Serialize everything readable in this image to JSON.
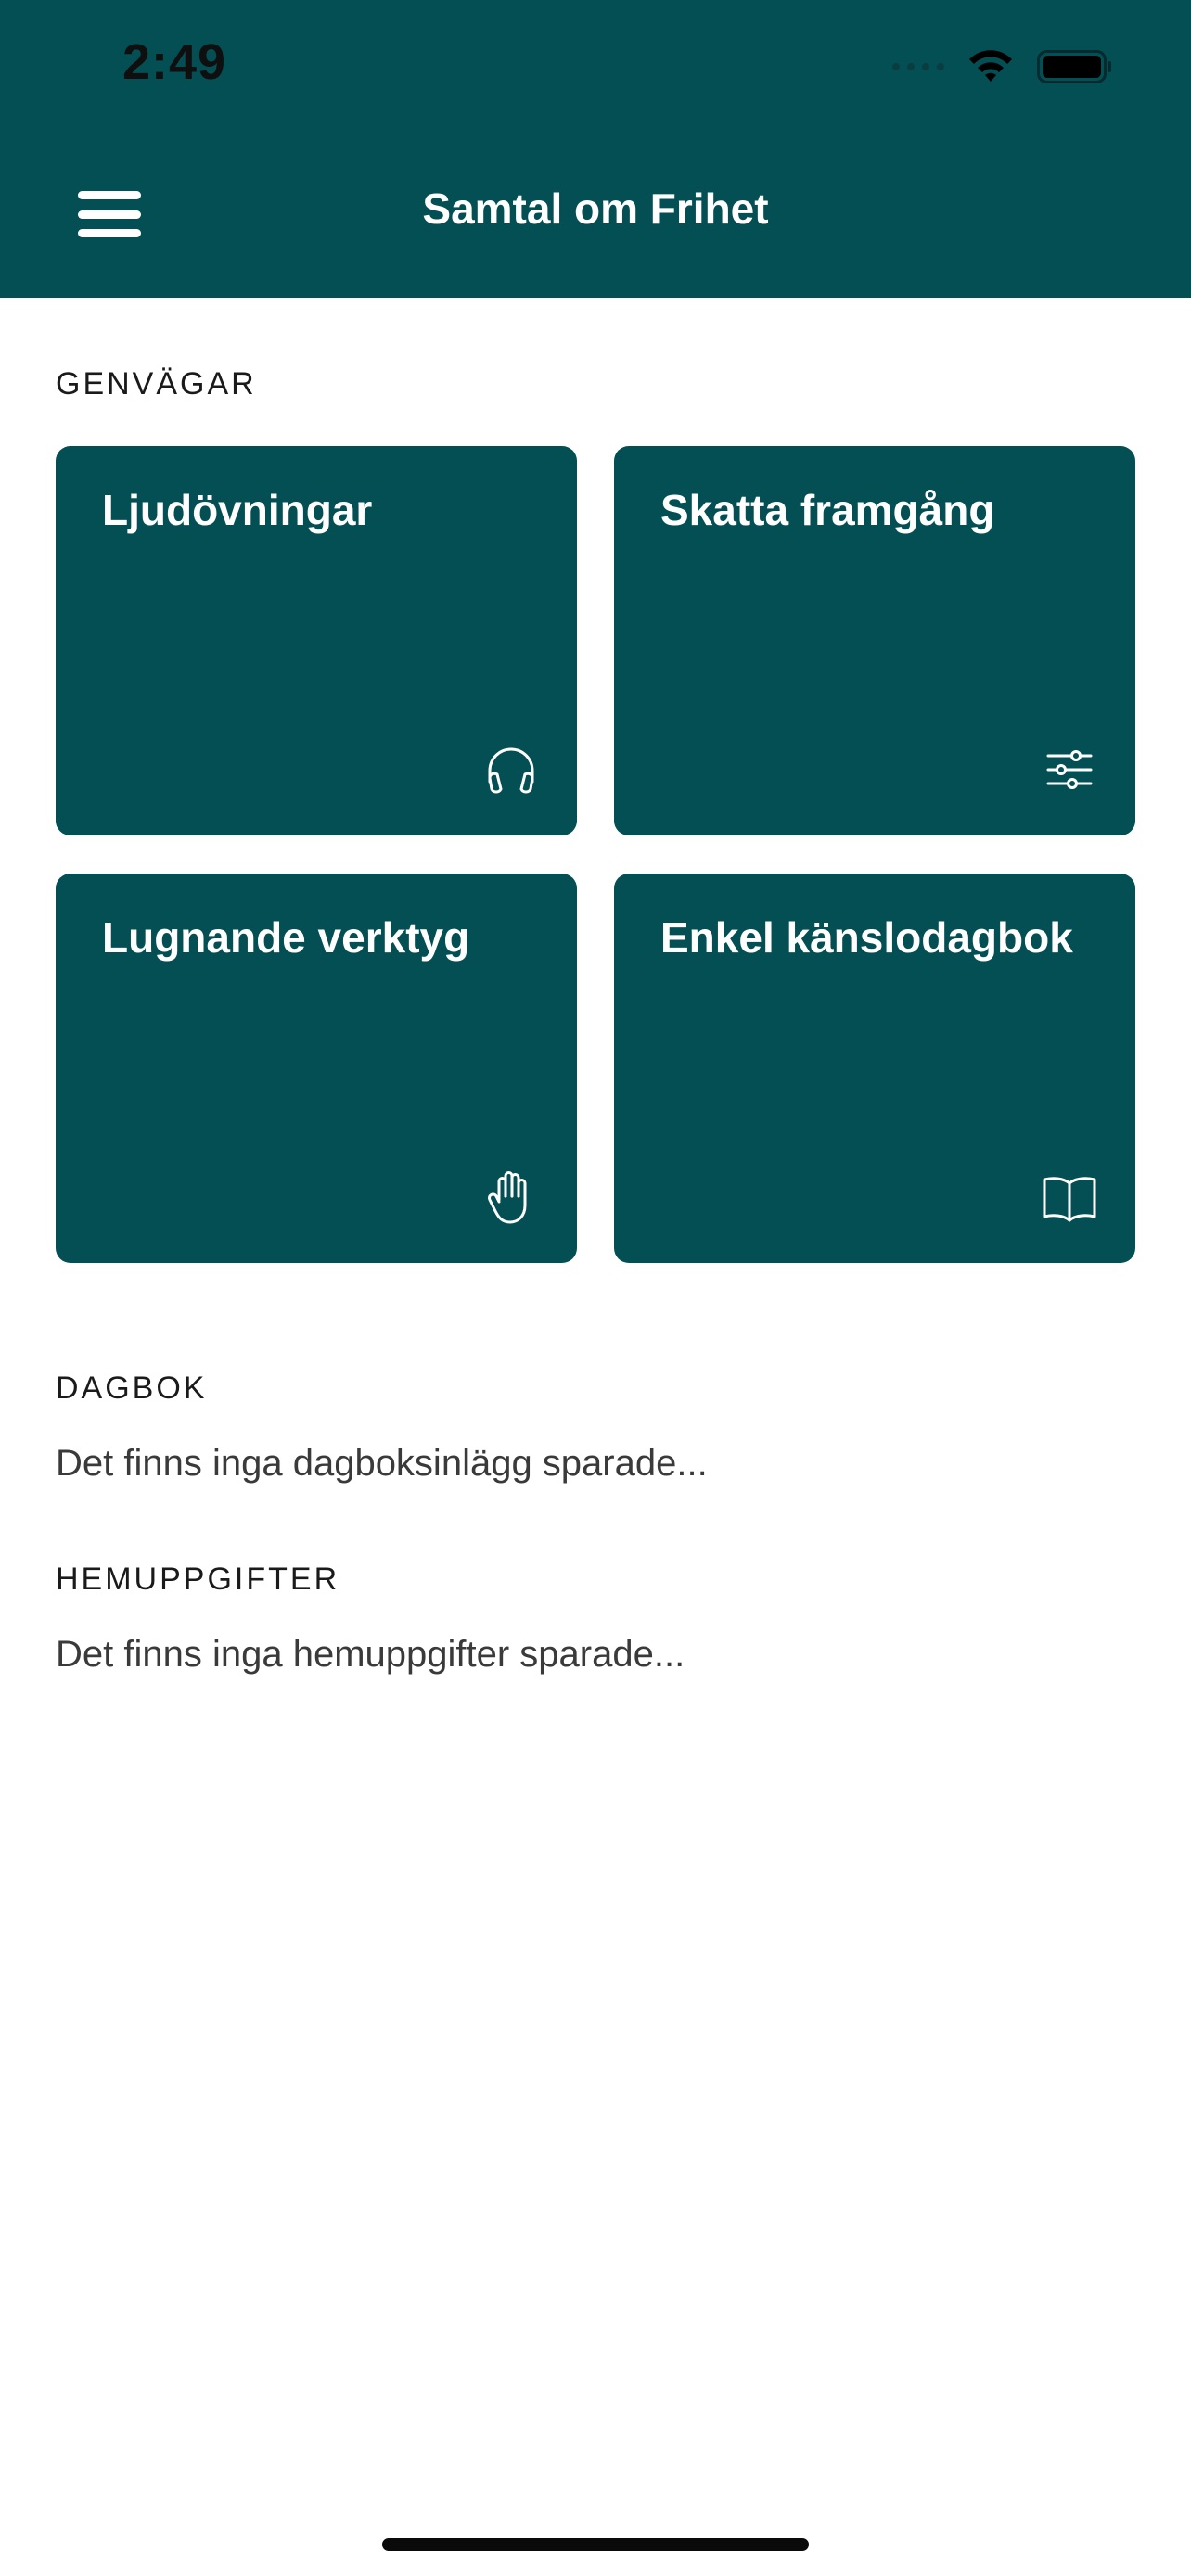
{
  "status_bar": {
    "time": "2:49"
  },
  "header": {
    "title": "Samtal om Frihet"
  },
  "shortcuts": {
    "heading": "GENVÄGAR",
    "tiles": [
      {
        "label": "Ljudövningar",
        "icon": "headphones-icon"
      },
      {
        "label": "Skatta framgång",
        "icon": "sliders-icon"
      },
      {
        "label": "Lugnande verktyg",
        "icon": "hand-icon"
      },
      {
        "label": "Enkel känslodagbok",
        "icon": "book-icon"
      }
    ]
  },
  "diary": {
    "heading": "DAGBOK",
    "empty_text": "Det finns inga dagboksinlägg sparade..."
  },
  "homework": {
    "heading": "HEMUPPGIFTER",
    "empty_text": "Det finns inga hemuppgifter sparade..."
  },
  "colors": {
    "brand": "#034f54",
    "background": "#ffffff",
    "text": "#3a3a3a"
  }
}
